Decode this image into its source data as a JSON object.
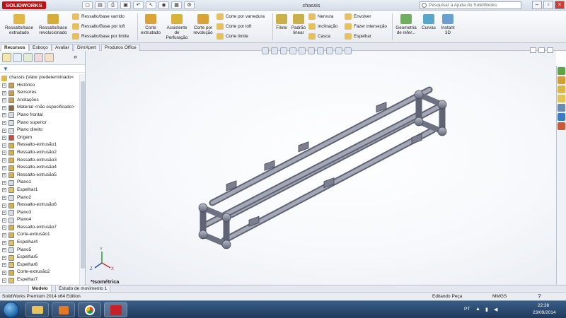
{
  "app": {
    "logo": "SOLIDWORKS",
    "title": "chassis",
    "search_placeholder": "Pesquisar a Ajuda do SolidWorks"
  },
  "ribbon": {
    "big": [
      {
        "label1": "Ressalto/base",
        "label2": "extrudado"
      },
      {
        "label1": "Ressalto/base",
        "label2": "revolucionado"
      },
      {
        "label1": "Corte",
        "label2": "extrudado"
      },
      {
        "label1": "Assistente",
        "label2": "de",
        "label3": "Perfuração"
      },
      {
        "label1": "Corte por",
        "label2": "revolução"
      },
      {
        "label1": "Filete",
        "label2": ""
      },
      {
        "label1": "Padrão",
        "label2": "linear"
      },
      {
        "label1": "Geometria",
        "label2": "de refer..."
      },
      {
        "label1": "Curvas",
        "label2": ""
      },
      {
        "label1": "Instant",
        "label2": "3D"
      }
    ],
    "small": [
      "Ressalto/base varrido",
      "Ressalto/Base por loft",
      "Ressalto/base por limite",
      "Corte por varredura",
      "Corte por loft",
      "Corte limite",
      "Nervura",
      "Inclinação",
      "Casca",
      "Envolver",
      "Fazer interseção",
      "Espelhar"
    ]
  },
  "panel_tabs": [
    "Recursos",
    "Esboço",
    "Avaliar",
    "DimXpert",
    "Produtos Office"
  ],
  "tree": {
    "root": "chassis  (Valor predeterminado<",
    "items": [
      {
        "label": "Histórico",
        "color": "#c8a04a"
      },
      {
        "label": "Sensores",
        "color": "#c8a04a"
      },
      {
        "label": "Anotações",
        "color": "#c8a04a"
      },
      {
        "label": "Material <não especificado>",
        "color": "#8a6a3a"
      },
      {
        "label": "Plano frontal",
        "color": "#d9dde3"
      },
      {
        "label": "Plano superior",
        "color": "#d9dde3"
      },
      {
        "label": "Plano direito",
        "color": "#d9dde3"
      },
      {
        "label": "Origem",
        "color": "#c94a3a"
      },
      {
        "label": "Ressalto-extrusão1",
        "color": "#d4b14a"
      },
      {
        "label": "Ressalto-extrusão2",
        "color": "#d4b14a"
      },
      {
        "label": "Ressalto-extrusão3",
        "color": "#d4b14a"
      },
      {
        "label": "Ressalto-extrusão4",
        "color": "#d4b14a"
      },
      {
        "label": "Ressalto-extrusão5",
        "color": "#d4b14a"
      },
      {
        "label": "Plano1",
        "color": "#d9dde3"
      },
      {
        "label": "Espelhar1",
        "color": "#e0c35a"
      },
      {
        "label": "Plano2",
        "color": "#d9dde3"
      },
      {
        "label": "Ressalto-extrusão6",
        "color": "#d4b14a"
      },
      {
        "label": "Plano3",
        "color": "#d9dde3"
      },
      {
        "label": "Plano4",
        "color": "#d9dde3"
      },
      {
        "label": "Ressalto-extrusão7",
        "color": "#d4b14a"
      },
      {
        "label": "Corte-extrusão1",
        "color": "#d4b14a"
      },
      {
        "label": "Espelhar4",
        "color": "#e0c35a"
      },
      {
        "label": "Plano5",
        "color": "#d9dde3"
      },
      {
        "label": "Espelhar5",
        "color": "#e0c35a"
      },
      {
        "label": "Espelhar6",
        "color": "#e0c35a"
      },
      {
        "label": "Corte-extrusão2",
        "color": "#d4b14a"
      },
      {
        "label": "Espelhar7",
        "color": "#e0c35a"
      }
    ]
  },
  "viewport": {
    "view_label": "*Isométrica",
    "axes": {
      "x": "X",
      "y": "Y",
      "z": "Z"
    }
  },
  "model_tabs": [
    "Modelo",
    "Estudo de movimento 1"
  ],
  "status": {
    "left": "SolidWorks Premium 2014 x64 Edition",
    "mode": "Editando Peça",
    "units": "MMGS"
  },
  "taskbar": {
    "lang": "PT",
    "time": "22:38",
    "date": "23/09/2014"
  },
  "colors": {
    "brand": "#b4151b",
    "model_metal": "#8f93a3"
  }
}
